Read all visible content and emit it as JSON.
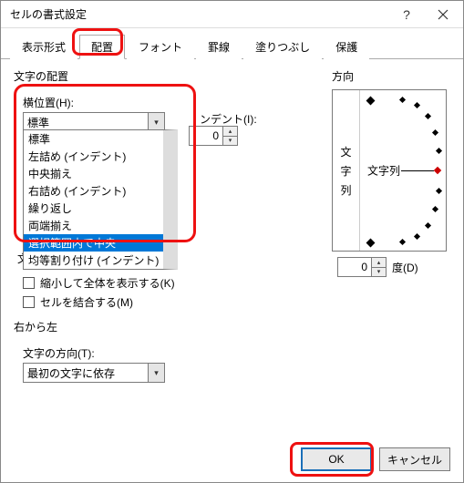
{
  "title": "セルの書式設定",
  "tabs": [
    "表示形式",
    "配置",
    "フォント",
    "罫線",
    "塗りつぶし",
    "保護"
  ],
  "textAlign": {
    "legend": "文字の配置",
    "hLabel": "横位置(H):",
    "hValue": "標準",
    "options": [
      "標準",
      "左詰め (インデント)",
      "中央揃え",
      "右詰め (インデント)",
      "繰り返し",
      "両端揃え",
      "選択範囲内で中央",
      "均等割り付け (インデント)"
    ],
    "selectedIndex": 6,
    "indentLabel": "ンデント(I):",
    "indentValue": "0",
    "vLabelHidden": "文"
  },
  "control": {
    "shrink": "縮小して全体を表示する(K)",
    "merge": "セルを結合する(M)"
  },
  "rtl": {
    "legend": "右から左",
    "dirLabel": "文字の方向(T):",
    "dirValue": "最初の文字に依存"
  },
  "orientation": {
    "legend": "方向",
    "vertical": [
      "文",
      "字",
      "列"
    ],
    "dialText": "文字列",
    "degValue": "0",
    "degLabel": "度(D)"
  },
  "buttons": {
    "ok": "OK",
    "cancel": "キャンセル"
  }
}
